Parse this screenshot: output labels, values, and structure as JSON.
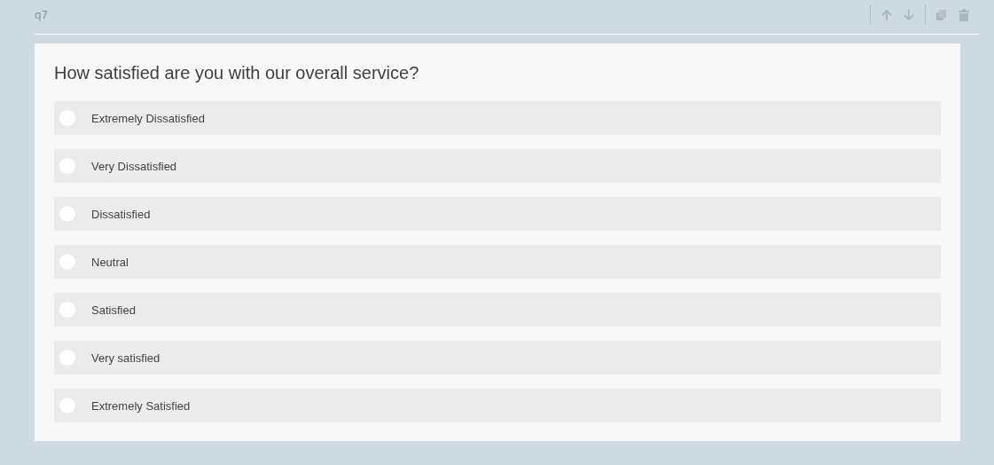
{
  "question": {
    "id": "q7",
    "title": "How satisfied are you with our overall service?",
    "options": [
      {
        "label": "Extremely Dissatisfied",
        "selected": false
      },
      {
        "label": "Very Dissatisfied",
        "selected": false
      },
      {
        "label": "Dissatisfied",
        "selected": false
      },
      {
        "label": "Neutral",
        "selected": false
      },
      {
        "label": "Satisfied",
        "selected": false
      },
      {
        "label": "Very satisfied",
        "selected": false
      },
      {
        "label": "Extremely Satisfied",
        "selected": false
      }
    ]
  }
}
